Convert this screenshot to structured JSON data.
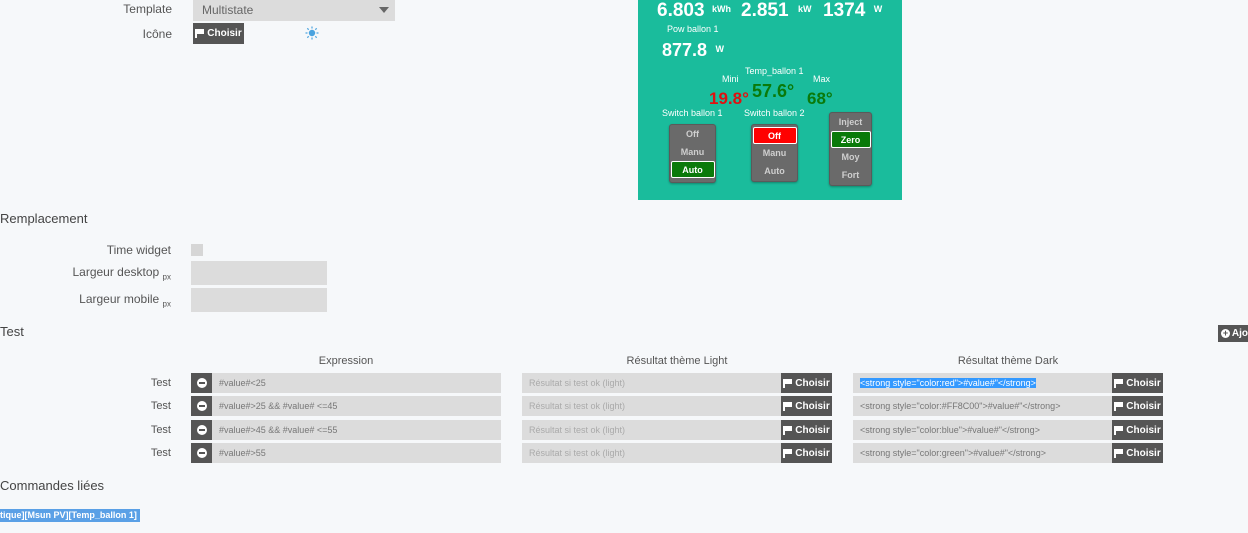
{
  "form": {
    "template_label": "Template",
    "template_value": "Multistate",
    "icon_label": "Icône",
    "icon_button": "Choisir"
  },
  "widget": {
    "energy_value": "6.803",
    "energy_unit": "kWh",
    "power_value": "2.851",
    "power_unit": "kW",
    "watt_value": "1374",
    "watt_unit": "W",
    "pow_label": "Pow ballon 1",
    "pow_value": "877.8",
    "pow_unit": "W",
    "mini_label": "Mini",
    "mini_value": "19.8°",
    "temp_label": "Temp_ballon 1",
    "temp_value": "57.6°",
    "max_label": "Max",
    "max_value": "68°",
    "switch1_label": "Switch ballon 1",
    "switch1_options": [
      "Off",
      "Manu",
      "Auto"
    ],
    "switch2_label": "Switch ballon 2",
    "switch2_options": [
      "Off",
      "Manu",
      "Auto"
    ],
    "switch3_options": [
      "Inject",
      "Zero",
      "Moy",
      "Fort"
    ],
    "colors": {
      "background": "#1abc9c",
      "mini": "#e01010",
      "temp": "#0a7a0a",
      "max": "#0a7a0a"
    }
  },
  "replacement": {
    "title": "Remplacement",
    "time_widget_label": "Time widget",
    "desktop_width_label": "Largeur desktop",
    "desktop_width_unit": "px",
    "mobile_width_label": "Largeur mobile",
    "mobile_width_unit": "px"
  },
  "test": {
    "title": "Test",
    "add_button": "Ajo",
    "col_expression": "Expression",
    "col_light": "Résultat thème Light",
    "col_dark": "Résultat thème Dark",
    "choose_label": "Choisir",
    "rows": [
      {
        "label": "Test",
        "expression": "#value#<25",
        "light_placeholder": "Résultat si test ok (light)",
        "dark": "<strong style=\"color:red\">#value#\"</strong>"
      },
      {
        "label": "Test",
        "expression": "#value#>25 && #value# <=45",
        "light_placeholder": "Résultat si test ok (light)",
        "dark": "<strong style=\"color:#FF8C00\">#value#\"</strong>"
      },
      {
        "label": "Test",
        "expression": "#value#>45 && #value# <=55",
        "light_placeholder": "Résultat si test ok (light)",
        "dark": "<strong style=\"color:blue\">#value#\"</strong>"
      },
      {
        "label": "Test",
        "expression": "#value#>55",
        "light_placeholder": "Résultat si test ok (light)",
        "dark": "<strong style=\"color:green\">#value#\"</strong>"
      }
    ]
  },
  "linked": {
    "title": "Commandes liées",
    "command": "tique][Msun PV][Temp_ballon 1]"
  }
}
